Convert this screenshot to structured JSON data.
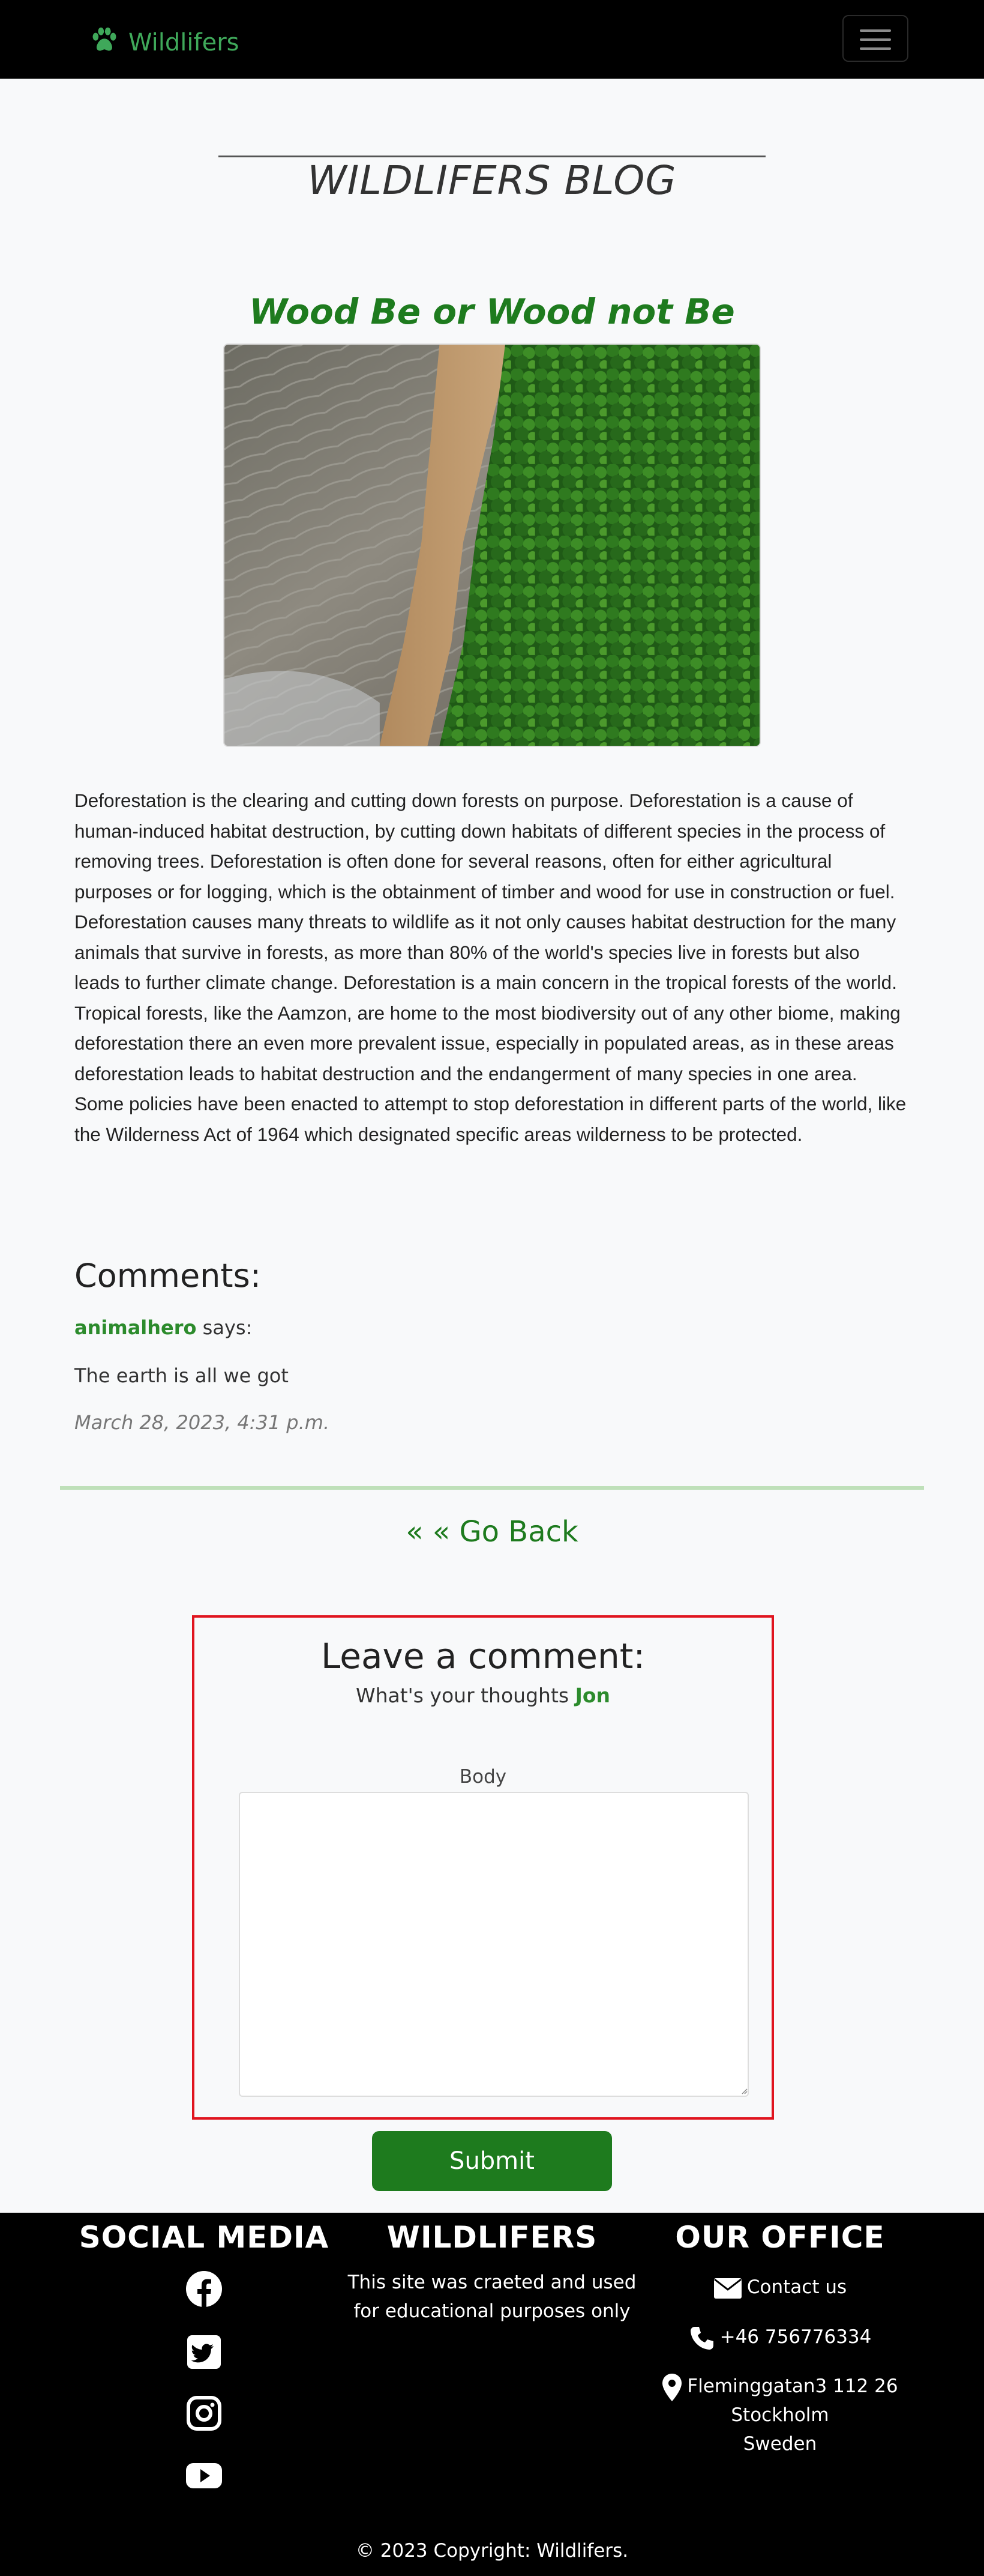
{
  "nav": {
    "brand": "Wildlifers",
    "brand_icon": "paw-icon",
    "menu_icon": "hamburger-menu-icon"
  },
  "blog": {
    "title": "WILDLIFERS BLOG"
  },
  "post": {
    "title": "Wood Be or Wood not Be",
    "image_alt": "Aerial view of deforested land next to rainforest",
    "body": "Deforestation is the clearing and cutting down forests on purpose. Deforestation is a cause of human-induced habitat destruction, by cutting down habitats of different species in the process of removing trees. Deforestation is often done for several reasons, often for either agricultural purposes or for logging, which is the obtainment of timber and wood for use in construction or fuel. Deforestation causes many threats to wildlife as it not only causes habitat destruction for the many animals that survive in forests, as more than 80% of the world's species live in forests but also leads to further climate change. Deforestation is a main concern in the tropical forests of the world. Tropical forests, like the Aamzon, are home to the most biodiversity out of any other biome, making deforestation there an even more prevalent issue, especially in populated areas, as in these areas deforestation leads to habitat destruction and the endangerment of many species in one area. Some policies have been enacted to attempt to stop deforestation in different parts of the world, like the Wilderness Act of 1964 which designated specific areas wilderness to be protected."
  },
  "comments": {
    "heading": "Comments:",
    "items": [
      {
        "author": "animalhero",
        "says": " says:",
        "body": "The earth is all we got",
        "date": "March 28, 2023, 4:31 p.m."
      }
    ]
  },
  "go_back": "« « Go Back",
  "leave_comment": {
    "heading": "Leave a comment:",
    "prompt": "What's your thoughts ",
    "user": "Jon",
    "body_label": "Body",
    "body_value": "",
    "submit": "Submit"
  },
  "footer": {
    "social": {
      "heading": "SOCIAL MEDIA",
      "icons": [
        "facebook-icon",
        "twitter-icon",
        "instagram-icon",
        "youtube-icon"
      ]
    },
    "about": {
      "heading": "WILDLIFERS",
      "text": "This site was craeted and used for educational purposes only"
    },
    "office": {
      "heading": "OUR OFFICE",
      "contact": "Contact us",
      "phone": "+46 756776334",
      "address_line1": "Fleminggatan3 112 26",
      "address_line2": "Stockholm",
      "address_line3": "Sweden"
    },
    "copyright": "© 2023 Copyright: Wildlifers."
  },
  "colors": {
    "accent_green": "#1e7b1e",
    "brand_green": "#3fa85a",
    "highlight_border": "#e0141e",
    "nav_bg": "#000000"
  }
}
